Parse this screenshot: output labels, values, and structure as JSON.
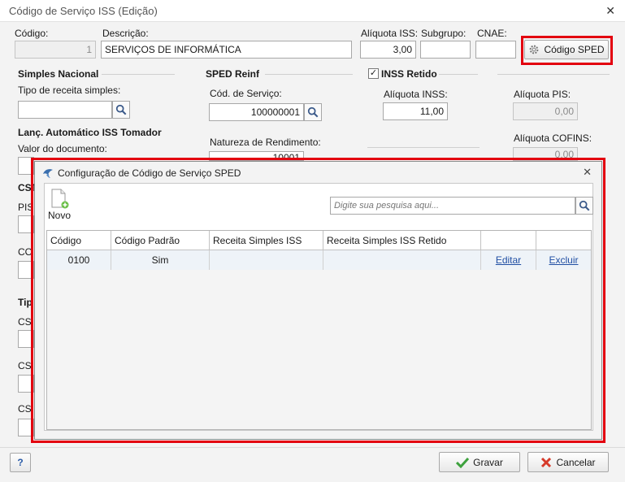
{
  "window": {
    "title": "Código de Serviço ISS (Edição)",
    "close": "✕"
  },
  "header": {
    "codigo_label": "Código:",
    "codigo_value": "1",
    "descricao_label": "Descrição:",
    "descricao_value": "SERVIÇOS DE INFORMÁTICA",
    "aliquota_iss_label": "Alíquota ISS:",
    "aliquota_iss_value": "3,00",
    "subgrupo_label": "Subgrupo:",
    "subgrupo_value": "",
    "cnae_label": "CNAE:",
    "cnae_value": "",
    "codigo_sped_label": "Código SPED"
  },
  "simples": {
    "title": "Simples Nacional",
    "tipo_receita_label": "Tipo de receita simples:",
    "tipo_receita_value": ""
  },
  "lanc": {
    "title": "Lanç. Automático ISS Tomador",
    "valor_doc_label": "Valor do documento:"
  },
  "reinf": {
    "title": "SPED Reinf",
    "cod_servico_label": "Cód. de Serviço:",
    "cod_servico_value": "100000001",
    "natureza_label": "Natureza de Rendimento:",
    "natureza_value": "10001"
  },
  "inss": {
    "title": "INSS Retido",
    "checked": "✓",
    "aliquota_label": "Alíquota INSS:",
    "aliquota_value": "11,00"
  },
  "pis": {
    "label": "Alíquota PIS:",
    "value": "0,00"
  },
  "cofins": {
    "label": "Alíquota COFINS:",
    "value": "0,00"
  },
  "left_partial": {
    "cst": "CST",
    "pis": "PIS",
    "co": "CO",
    "tip": "Tip",
    "cs1": "CS",
    "cs2": "CS",
    "cs3": "CS"
  },
  "footer": {
    "help": "?",
    "gravar": "Gravar",
    "cancelar": "Cancelar"
  },
  "dialog": {
    "title": "Configuração de Código de Serviço SPED",
    "close": "✕",
    "novo": "Novo",
    "search_placeholder": "Digite sua pesquisa aqui...",
    "columns": [
      "Código",
      "Código Padrão",
      "Receita Simples ISS",
      "Receita Simples ISS Retido",
      "",
      ""
    ],
    "rows": [
      {
        "codigo": "0100",
        "padrao": "Sim",
        "receita_iss": "",
        "receita_iss_retido": "",
        "editar": "Editar",
        "excluir": "Excluir"
      }
    ]
  },
  "colors": {
    "highlight": "#e3000f",
    "link": "#1f4ea3",
    "selected_row": "#eef3f8"
  }
}
